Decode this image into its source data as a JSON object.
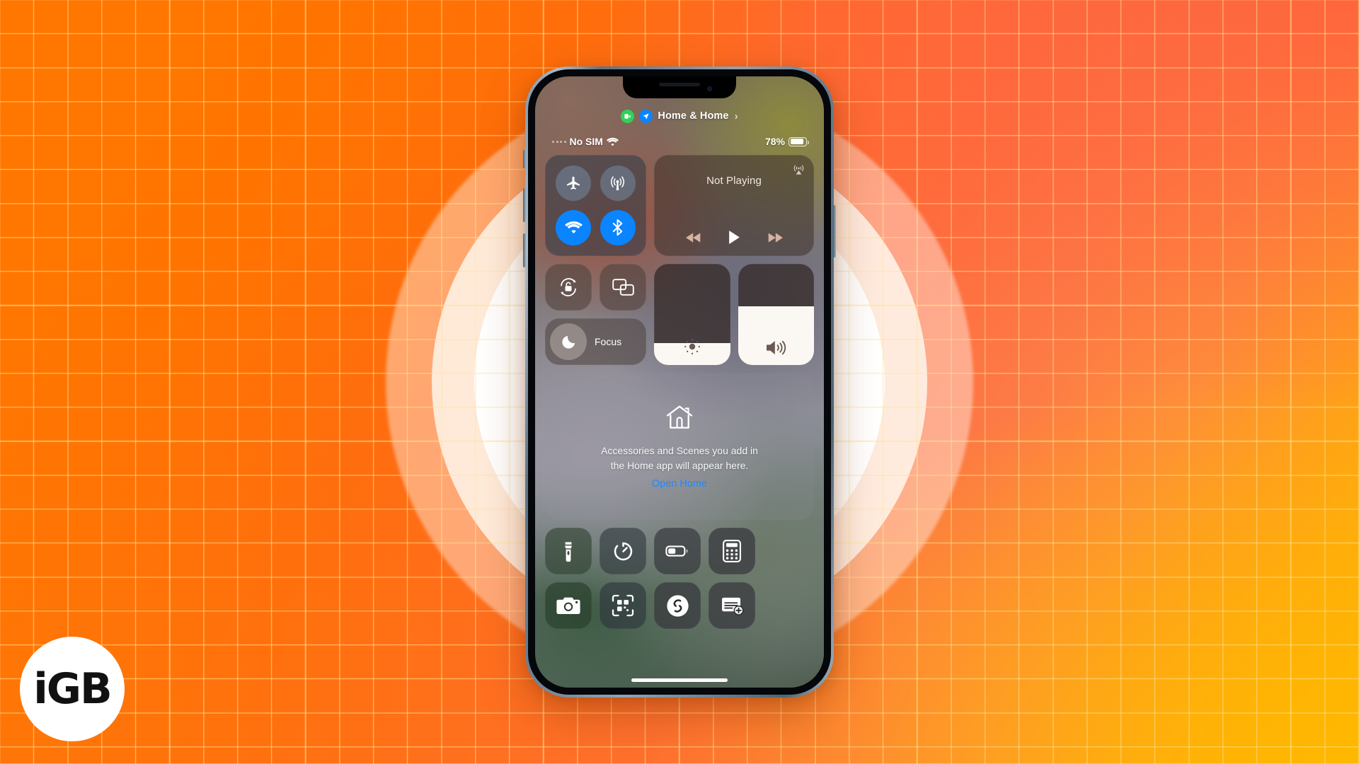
{
  "background": {
    "gradient_from": "#FF7A00",
    "gradient_via": "#FF6A3C",
    "gradient_to": "#FFB300",
    "grid_line_color": "#FFE496",
    "glow_ring_color": "#FFFFFF"
  },
  "logo": {
    "text": "iGB",
    "shape": "circle",
    "bg": "#FFFFFF",
    "fg": "#111111"
  },
  "phone": {
    "frame_color": "#7D93A8",
    "notch_label": "notch",
    "home_indicator_label": "home-indicator",
    "side_buttons": [
      "silent-switch",
      "volume-up",
      "volume-down",
      "power"
    ]
  },
  "control_center": {
    "home_header": {
      "facetime_icon": "video-camera-icon",
      "location_icon": "location-arrow-icon",
      "label": "Home & Home",
      "chevron": "›"
    },
    "status_bar": {
      "sim_text": "No SIM",
      "wifi_icon": "wifi-icon",
      "battery_percent": "78%",
      "battery_level": 78
    },
    "connectivity": {
      "tiles": [
        {
          "name": "airplane-mode-toggle",
          "icon": "airplane-icon",
          "state": "off"
        },
        {
          "name": "cellular-data-toggle",
          "icon": "cellular-antenna-icon",
          "state": "off"
        },
        {
          "name": "wifi-toggle",
          "icon": "wifi-icon",
          "state": "on"
        },
        {
          "name": "bluetooth-toggle",
          "icon": "bluetooth-icon",
          "state": "on"
        }
      ],
      "accent_on": "#0A84FF",
      "accent_off": "rgba(128,170,205,0.36)"
    },
    "media": {
      "title": "Not Playing",
      "airplay_icon": "airplay-audio-icon",
      "controls": [
        {
          "name": "rewind-button",
          "icon": "rewind-icon"
        },
        {
          "name": "play-button",
          "icon": "play-icon"
        },
        {
          "name": "fast-forward-button",
          "icon": "fast-forward-icon"
        }
      ]
    },
    "quick_toggles": [
      {
        "name": "rotation-lock-toggle",
        "icon": "rotation-lock-icon"
      },
      {
        "name": "screen-mirroring-toggle",
        "icon": "screen-mirroring-icon"
      }
    ],
    "focus": {
      "label": "Focus",
      "icon": "moon-icon"
    },
    "sliders": [
      {
        "name": "brightness-slider",
        "icon": "brightness-icon",
        "value": 22
      },
      {
        "name": "volume-slider",
        "icon": "speaker-icon",
        "value": 58
      }
    ],
    "home_panel": {
      "icon": "house-icon",
      "description_line1": "Accessories and Scenes you add in",
      "description_line2": "the Home app will appear here.",
      "link": "Open Home",
      "link_color": "#1F8BFF"
    },
    "shortcuts_row1": [
      {
        "name": "flashlight-button",
        "icon": "flashlight-icon"
      },
      {
        "name": "timer-button",
        "icon": "timer-icon"
      },
      {
        "name": "low-power-mode-button",
        "icon": "battery-icon"
      },
      {
        "name": "calculator-button",
        "icon": "calculator-icon"
      }
    ],
    "shortcuts_row2": [
      {
        "name": "camera-button",
        "icon": "camera-icon"
      },
      {
        "name": "code-scanner-button",
        "icon": "qr-scanner-icon"
      },
      {
        "name": "shazam-button",
        "icon": "shazam-icon"
      },
      {
        "name": "quick-note-button",
        "icon": "quick-note-icon"
      }
    ]
  }
}
